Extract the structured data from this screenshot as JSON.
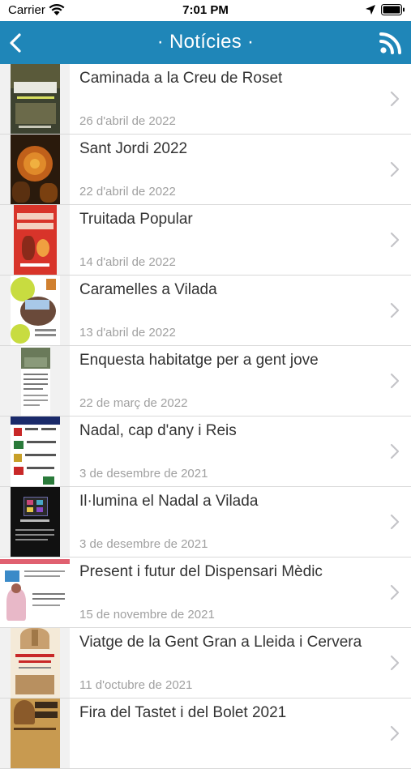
{
  "status_bar": {
    "carrier": "Carrier",
    "time": "7:01 PM"
  },
  "header": {
    "title": "· Notícies ·",
    "back_icon": "chevron-left-icon",
    "feed_icon": "rss-icon",
    "color": "#1f86b8"
  },
  "news": [
    {
      "title": "Caminada a la Creu de Roset",
      "date": "26 d'abril de 2022"
    },
    {
      "title": "Sant Jordi 2022",
      "date": "22 d'abril de 2022"
    },
    {
      "title": "Truitada Popular",
      "date": "14 d'abril de 2022"
    },
    {
      "title": "Caramelles a Vilada",
      "date": "13 d'abril de 2022"
    },
    {
      "title": "Enquesta habitatge per a gent jove",
      "date": "22 de març de 2022"
    },
    {
      "title": "Nadal, cap d'any i Reis",
      "date": "3 de desembre de 2021"
    },
    {
      "title": "Il·lumina el Nadal a Vilada",
      "date": "3 de desembre de 2021"
    },
    {
      "title": "Present i futur del Dispensari Mèdic",
      "date": "15 de novembre de 2021"
    },
    {
      "title": "Viatge de la Gent Gran a Lleida i Cervera",
      "date": "11 d'octubre de 2021"
    },
    {
      "title": "Fira del Tastet i del Bolet 2021",
      "date": ""
    }
  ]
}
